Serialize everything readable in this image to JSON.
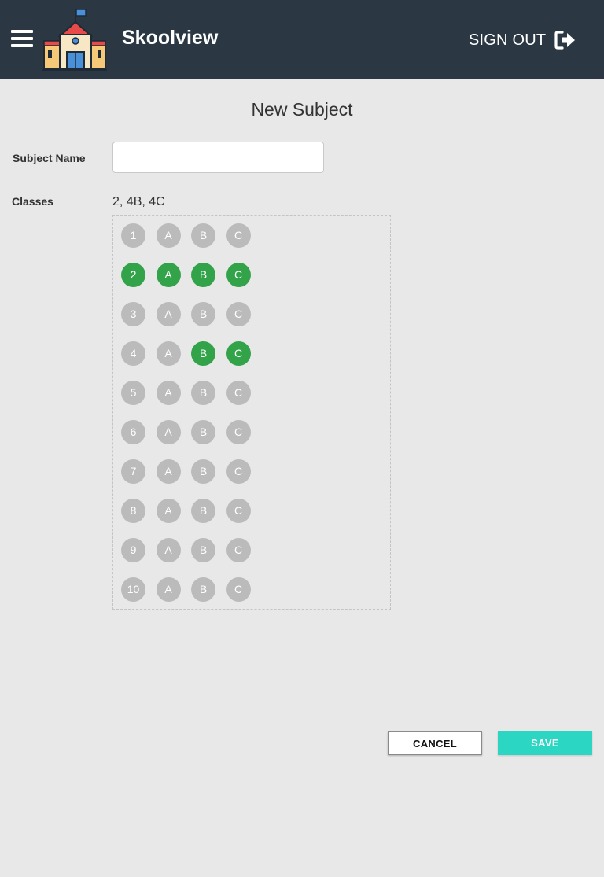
{
  "header": {
    "app_name": "Skoolview",
    "signout_label": "SIGN OUT",
    "menu_icon": "hamburger-menu-icon",
    "logo": "school-building-logo",
    "signout_icon": "sign-out-arrow-icon",
    "background_color": "#2b3844"
  },
  "form": {
    "title": "New Subject",
    "subject_name_label": "Subject Name",
    "subject_name_value": "",
    "classes_label": "Classes",
    "selected_classes": "2, 4B, 4C"
  },
  "class_grid": {
    "rows": [
      {
        "grade": "1",
        "sections": [
          "A",
          "B",
          "C"
        ],
        "grade_on": false,
        "sections_on": [
          false,
          false,
          false
        ]
      },
      {
        "grade": "2",
        "sections": [
          "A",
          "B",
          "C"
        ],
        "grade_on": true,
        "sections_on": [
          true,
          true,
          true
        ]
      },
      {
        "grade": "3",
        "sections": [
          "A",
          "B",
          "C"
        ],
        "grade_on": false,
        "sections_on": [
          false,
          false,
          false
        ]
      },
      {
        "grade": "4",
        "sections": [
          "A",
          "B",
          "C"
        ],
        "grade_on": false,
        "sections_on": [
          false,
          true,
          true
        ]
      },
      {
        "grade": "5",
        "sections": [
          "A",
          "B",
          "C"
        ],
        "grade_on": false,
        "sections_on": [
          false,
          false,
          false
        ]
      },
      {
        "grade": "6",
        "sections": [
          "A",
          "B",
          "C"
        ],
        "grade_on": false,
        "sections_on": [
          false,
          false,
          false
        ]
      },
      {
        "grade": "7",
        "sections": [
          "A",
          "B",
          "C"
        ],
        "grade_on": false,
        "sections_on": [
          false,
          false,
          false
        ]
      },
      {
        "grade": "8",
        "sections": [
          "A",
          "B",
          "C"
        ],
        "grade_on": false,
        "sections_on": [
          false,
          false,
          false
        ]
      },
      {
        "grade": "9",
        "sections": [
          "A",
          "B",
          "C"
        ],
        "grade_on": false,
        "sections_on": [
          false,
          false,
          false
        ]
      },
      {
        "grade": "10",
        "sections": [
          "A",
          "B",
          "C"
        ],
        "grade_on": false,
        "sections_on": [
          false,
          false,
          false
        ]
      }
    ],
    "selected_color": "#33a34a",
    "unselected_color": "#bbbbbb"
  },
  "actions": {
    "cancel_label": "CANCEL",
    "save_label": "SAVE",
    "save_color": "#2bd6c2"
  }
}
